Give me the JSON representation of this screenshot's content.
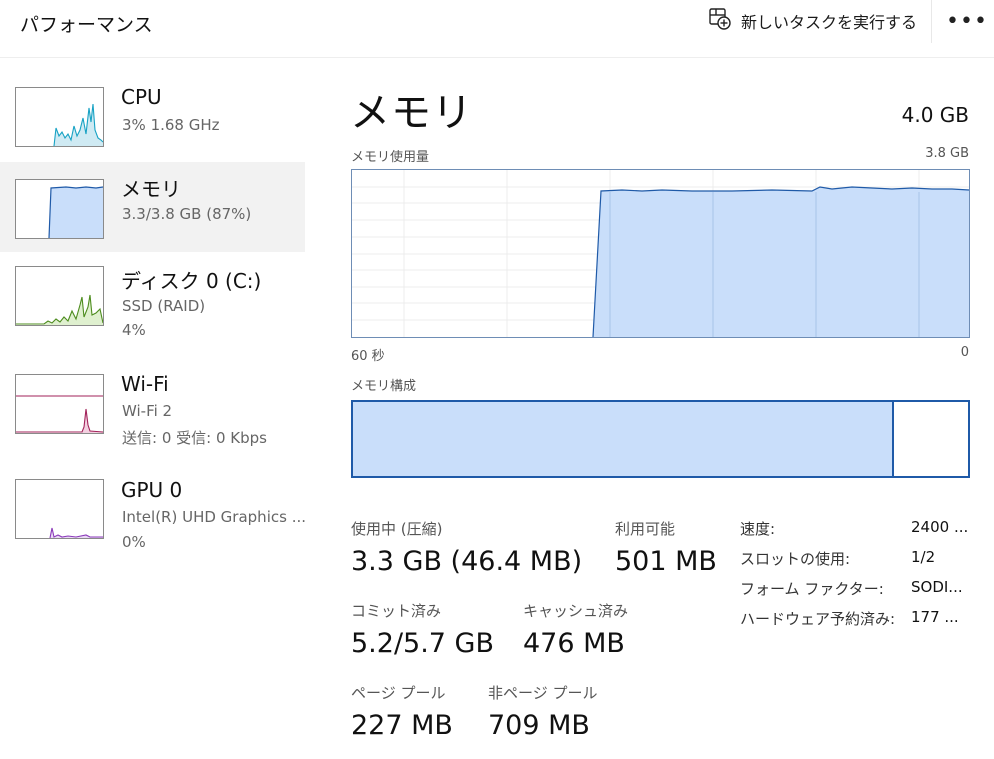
{
  "header": {
    "title": "パフォーマンス",
    "run_task_label": "新しいタスクを実行する",
    "more_label": "•••"
  },
  "sidebar": {
    "items": [
      {
        "id": "cpu",
        "title": "CPU",
        "line1": "3%  1.68 GHz",
        "line2": "",
        "color": "#17a2c4",
        "fill": "#cfeaf3"
      },
      {
        "id": "memory",
        "title": "メモリ",
        "line1": "3.3/3.8 GB (87%)",
        "line2": "",
        "color": "#1f5aa8",
        "fill": "#c9defa",
        "selected": true
      },
      {
        "id": "disk",
        "title": "ディスク 0 (C:)",
        "line1": "SSD (RAID)",
        "line2": "4%",
        "color": "#4d8c1e",
        "fill": "#dff0cf"
      },
      {
        "id": "wifi",
        "title": "Wi-Fi",
        "line1": "Wi-Fi 2",
        "line2": "送信: 0  受信: 0 Kbps",
        "color": "#a2225a",
        "fill": "#f3cfe0"
      },
      {
        "id": "gpu",
        "title": "GPU 0",
        "line1": "Intel(R) UHD Graphics ...",
        "line2": "0%",
        "color": "#8a3ab9",
        "fill": "#ead8f5"
      }
    ]
  },
  "main": {
    "title": "メモリ",
    "total": "4.0 GB",
    "graph_label": "メモリ使用量",
    "graph_max": "3.8 GB",
    "graph_left": "60 秒",
    "graph_right": "0",
    "composition_label": "メモリ構成",
    "composition_in_use_fraction": 0.87,
    "stats": {
      "in_use_label": "使用中 (圧縮)",
      "in_use_value": "3.3 GB (46.4 MB)",
      "available_label": "利用可能",
      "available_value": "501 MB",
      "committed_label": "コミット済み",
      "committed_value": "5.2/5.7 GB",
      "cached_label": "キャッシュ済み",
      "cached_value": "476 MB",
      "paged_label": "ページ プール",
      "paged_value": "227 MB",
      "nonpaged_label": "非ページ プール",
      "nonpaged_value": "709 MB"
    },
    "properties": [
      {
        "label": "速度:",
        "value": "2400 ..."
      },
      {
        "label": "スロットの使用:",
        "value": "1/2"
      },
      {
        "label": "フォーム ファクター:",
        "value": "SODI..."
      },
      {
        "label": "ハードウェア予約済み:",
        "value": "177 ..."
      }
    ]
  },
  "icons": {
    "run_task": "new-task-icon",
    "more": "more-options-icon"
  }
}
